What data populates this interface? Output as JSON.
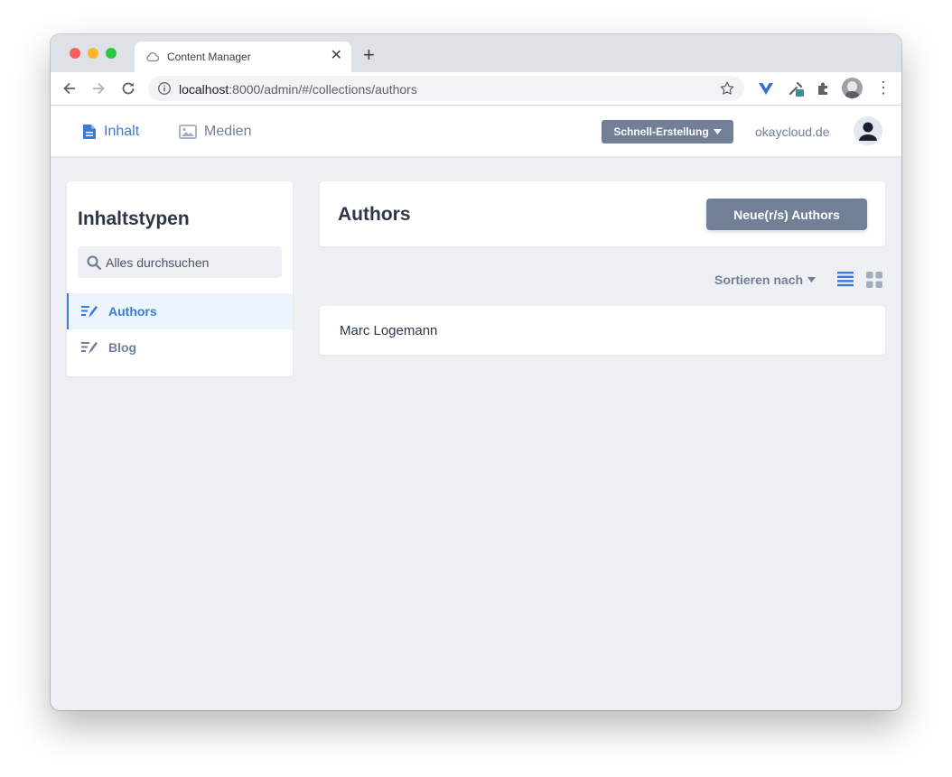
{
  "browser": {
    "tab_title": "Content Manager",
    "url_host": "localhost",
    "url_rest": ":8000/admin/#/collections/authors"
  },
  "header": {
    "nav": [
      {
        "label": "Inhalt",
        "icon": "document-icon",
        "active": true
      },
      {
        "label": "Medien",
        "icon": "image-icon",
        "active": false
      }
    ],
    "quick_create_label": "Schnell-Erstellung",
    "site_name": "okaycloud.de",
    "accent_color": "#3a7bd5",
    "button_color": "#718096"
  },
  "sidebar": {
    "title": "Inhaltstypen",
    "search_placeholder": "Alles durchsuchen",
    "items": [
      {
        "label": "Authors",
        "icon": "edit-list-icon",
        "active": true
      },
      {
        "label": "Blog",
        "icon": "edit-list-icon",
        "active": false
      }
    ]
  },
  "main": {
    "title": "Authors",
    "new_button_label": "Neue(r/s) Authors",
    "sort_label": "Sortieren nach",
    "entries": [
      "Marc Logemann"
    ]
  }
}
